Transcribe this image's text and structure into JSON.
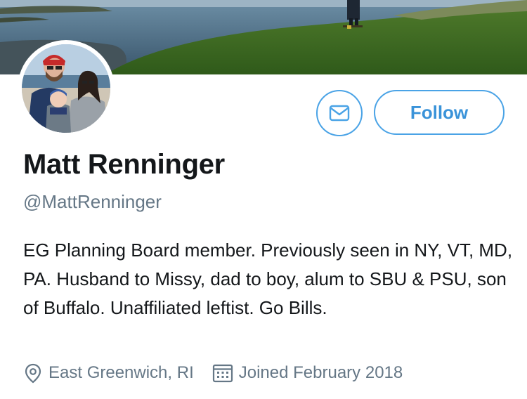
{
  "profile": {
    "name": "Matt Renninger",
    "handle": "@MattRenninger",
    "bio": "EG Planning Board member. Previously seen in NY, VT, MD, PA. Husband to Missy, dad to boy, alum to SBU & PSU, son of Buffalo. Unaffiliated leftist. Go Bills.",
    "location": "East Greenwich, RI",
    "joined": "Joined February 2018"
  },
  "actions": {
    "follow_label": "Follow",
    "message_icon": "envelope-icon"
  },
  "icons": {
    "location": "map-pin-icon",
    "joined": "calendar-icon"
  },
  "colors": {
    "accent": "#4aa3e6",
    "follow_text": "#3a93d9",
    "secondary_text": "#657786",
    "primary_text": "#14171a"
  }
}
